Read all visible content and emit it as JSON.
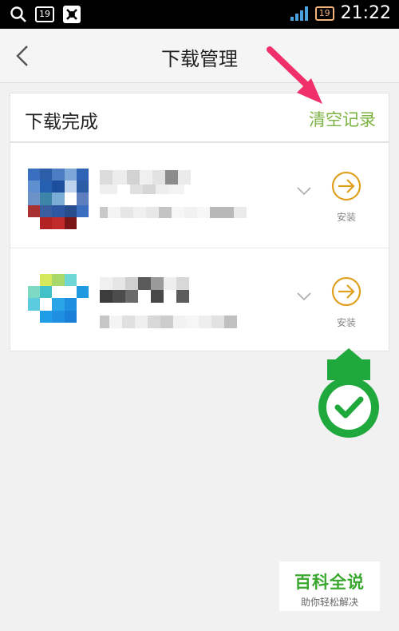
{
  "status_bar": {
    "notification_count": "19",
    "battery_level": "19",
    "time": "21:22"
  },
  "titlebar": {
    "title": "下载管理",
    "back_icon": "chevron-left-icon"
  },
  "header": {
    "section_label": "下载完成",
    "clear_label": "清空记录",
    "accent_color": "#7cb342"
  },
  "downloads": [
    {
      "install_label": "安装",
      "expand_icon": "chevron-down-icon",
      "install_icon": "arrow-right-circle-icon"
    },
    {
      "install_label": "安装",
      "expand_icon": "chevron-down-icon",
      "install_icon": "arrow-right-circle-icon"
    }
  ],
  "annotations": {
    "pointer_color": "#f0306a",
    "check_color": "#1fa83c"
  },
  "watermark": {
    "title": "百科全说",
    "subtitle": "助你轻松解决"
  }
}
